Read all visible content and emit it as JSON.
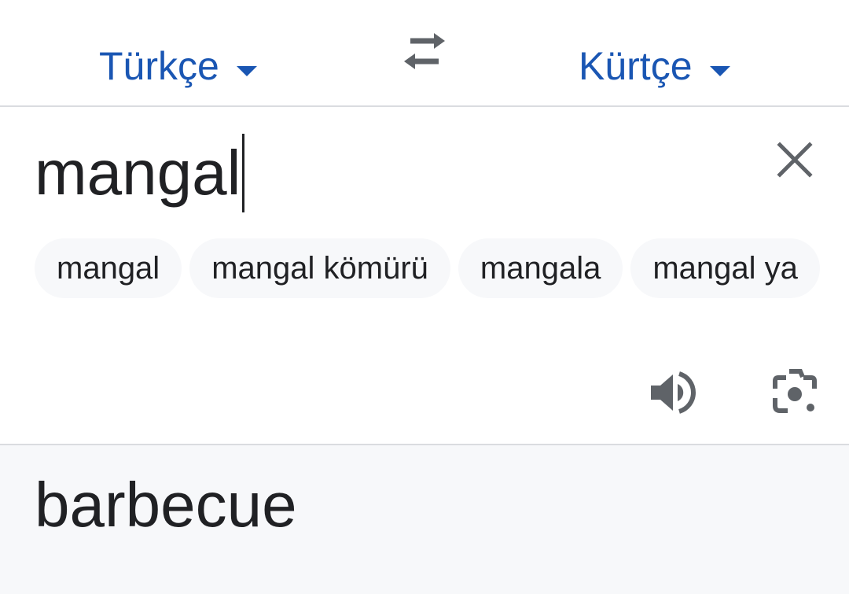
{
  "languages": {
    "source": "Türkçe",
    "target": "Kürtçe"
  },
  "input": {
    "text": "mangal"
  },
  "suggestions": [
    "mangal",
    "mangal kömürü",
    "mangala",
    "mangal ya"
  ],
  "output": {
    "translation": "barbecue"
  },
  "icons": {
    "caret": "caret-down-icon",
    "swap": "swap-icon",
    "clear": "close-icon",
    "speaker": "speaker-icon",
    "camera": "camera-lens-icon"
  },
  "colors": {
    "accent": "#1a56b3",
    "text": "#202124",
    "icon": "#5f6368",
    "divider": "#dadce0",
    "output_background": "#f7f8fa"
  }
}
